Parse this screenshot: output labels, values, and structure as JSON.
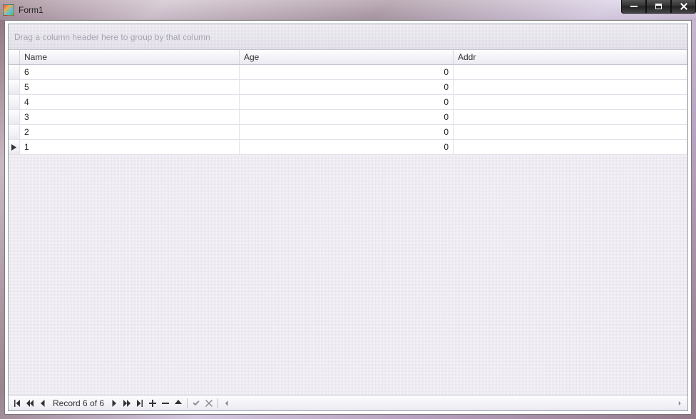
{
  "window": {
    "title": "Form1"
  },
  "grid": {
    "group_panel_text": "Drag a column header here to group by that column",
    "columns": {
      "name": "Name",
      "age": "Age",
      "addr": "Addr"
    },
    "rows": [
      {
        "name": "6",
        "age": "0",
        "addr": "",
        "current": false
      },
      {
        "name": "5",
        "age": "0",
        "addr": "",
        "current": false
      },
      {
        "name": "4",
        "age": "0",
        "addr": "",
        "current": false
      },
      {
        "name": "3",
        "age": "0",
        "addr": "",
        "current": false
      },
      {
        "name": "2",
        "age": "0",
        "addr": "",
        "current": false
      },
      {
        "name": "1",
        "age": "0",
        "addr": "",
        "current": true
      }
    ]
  },
  "navigator": {
    "record_text": "Record 6 of 6",
    "icons": {
      "first": "first-icon",
      "prev_page": "prev-page-icon",
      "prev": "prev-icon",
      "next": "next-icon",
      "next_page": "next-page-icon",
      "last": "last-icon",
      "add": "plus-icon",
      "remove": "minus-icon",
      "edit": "edit-icon",
      "end_edit": "check-icon",
      "cancel_edit": "x-icon"
    }
  }
}
